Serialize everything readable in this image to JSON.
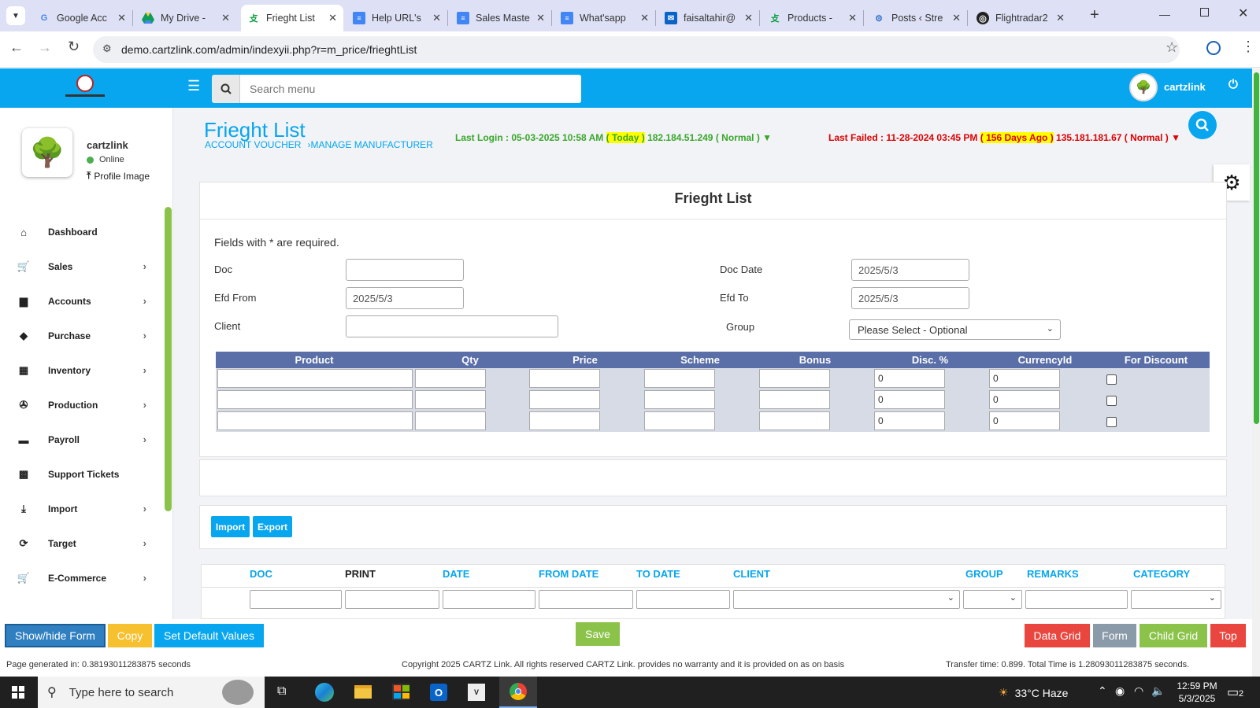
{
  "browser": {
    "tabs": [
      {
        "title": "Google Acc",
        "icon": "google-icon"
      },
      {
        "title": "My Drive - ",
        "icon": "drive-icon"
      },
      {
        "title": "Frieght List",
        "icon": "cartz-icon"
      },
      {
        "title": "Help URL's",
        "icon": "docs-icon"
      },
      {
        "title": "Sales Maste",
        "icon": "docs-icon"
      },
      {
        "title": "What'sapp",
        "icon": "docs-icon"
      },
      {
        "title": "faisaltahir@",
        "icon": "mail-icon"
      },
      {
        "title": "Products - ",
        "icon": "cartz-icon"
      },
      {
        "title": "Posts ‹ Stre",
        "icon": "wordpress-icon"
      },
      {
        "title": "Flightradar2",
        "icon": "flightradar-icon"
      }
    ],
    "url": "demo.cartzlink.com/admin/indexyii.php?r=m_price/frieghtList"
  },
  "header": {
    "search_placeholder": "Search menu",
    "username": "cartzlink"
  },
  "sidebar": {
    "profile": {
      "name": "cartzlink",
      "status": "Online",
      "image_link": "Profile Image"
    },
    "items": [
      {
        "label": "Dashboard",
        "icon": "home-icon",
        "has_children": false
      },
      {
        "label": "Sales",
        "icon": "cart-icon",
        "has_children": true
      },
      {
        "label": "Accounts",
        "icon": "briefcase-icon",
        "has_children": true
      },
      {
        "label": "Purchase",
        "icon": "tags-icon",
        "has_children": true
      },
      {
        "label": "Inventory",
        "icon": "grid-icon",
        "has_children": true
      },
      {
        "label": "Production",
        "icon": "cog-icon",
        "has_children": true
      },
      {
        "label": "Payroll",
        "icon": "money-icon",
        "has_children": true
      },
      {
        "label": "Support Tickets",
        "icon": "tickets-icon",
        "has_children": false
      },
      {
        "label": "Import",
        "icon": "import-icon",
        "has_children": true
      },
      {
        "label": "Target",
        "icon": "refresh-icon",
        "has_children": true
      },
      {
        "label": "E-Commerce",
        "icon": "cart-icon",
        "has_children": true
      }
    ]
  },
  "page": {
    "title": "Frieght List",
    "breadcrumb": [
      "ACCOUNT VOUCHER",
      "›MANAGE MANUFACTURER"
    ],
    "last_login": {
      "prefix": "Last Login : 05-03-2025 10:58 AM ",
      "badge": "( Today )",
      "rest": " 182.184.51.249 ( Normal ) ▼"
    },
    "last_failed": {
      "prefix": "Last Failed : 11-28-2024 03:45 PM ",
      "badge": "( 156 Days Ago )",
      "rest": " 135.181.181.67 ( Normal ) ▼"
    }
  },
  "form": {
    "heading": "Frieght List",
    "required_note": "Fields with * are required.",
    "doc_label": "Doc",
    "doc_value": "",
    "doc_date_label": "Doc Date",
    "doc_date_value": "2025/5/3",
    "efd_from_label": "Efd From",
    "efd_from_value": "2025/5/3",
    "efd_to_label": "Efd To",
    "efd_to_value": "2025/5/3",
    "client_label": "Client",
    "client_value": "",
    "group_label": "Group",
    "group_value": "Please Select - Optional"
  },
  "grid": {
    "columns": [
      "Product",
      "Qty",
      "Price",
      "Scheme",
      "Bonus",
      "Disc. %",
      "CurrencyId",
      "For Discount"
    ],
    "rows": [
      {
        "product": "",
        "qty": "",
        "price": "",
        "scheme": "",
        "bonus": "",
        "disc": "0",
        "currency": "0",
        "for_discount": false
      },
      {
        "product": "",
        "qty": "",
        "price": "",
        "scheme": "",
        "bonus": "",
        "disc": "0",
        "currency": "0",
        "for_discount": false
      },
      {
        "product": "",
        "qty": "",
        "price": "",
        "scheme": "",
        "bonus": "",
        "disc": "0",
        "currency": "0",
        "for_discount": false
      }
    ]
  },
  "actions": {
    "import": "Import",
    "export": "Export"
  },
  "list": {
    "columns": [
      "DOC",
      "PRINT",
      "DATE",
      "FROM DATE",
      "TO DATE",
      "CLIENT",
      "GROUP",
      "REMARKS",
      "CATEGORY"
    ]
  },
  "bottom": {
    "show_hide": "Show/hide Form",
    "copy": "Copy",
    "set_default": "Set Default Values",
    "save": "Save",
    "data_grid": "Data Grid",
    "form": "Form",
    "child_grid": "Child Grid",
    "top": "Top"
  },
  "footer": {
    "generated": "Page generated in: 0.38193011283875 seconds",
    "copyright": "Copyright 2025 CARTZ Link. All rights reserved CARTZ Link. provides no warranty and it is provided on as on basis",
    "transfer": "Transfer time: 0.899. Total Time is 1.28093011283875 seconds."
  },
  "taskbar": {
    "search_placeholder": "Type here to search",
    "weather": "33°C  Haze",
    "time": "12:59 PM",
    "date": "5/3/2025",
    "notifications": "2"
  },
  "colors": {
    "brand_blue": "#08a6ee",
    "grid_header": "#5a6ea8",
    "green": "#8bc34a",
    "login_green": "#3aa62a",
    "failed_red": "#e00000",
    "badge_yellow": "#ffff00"
  }
}
